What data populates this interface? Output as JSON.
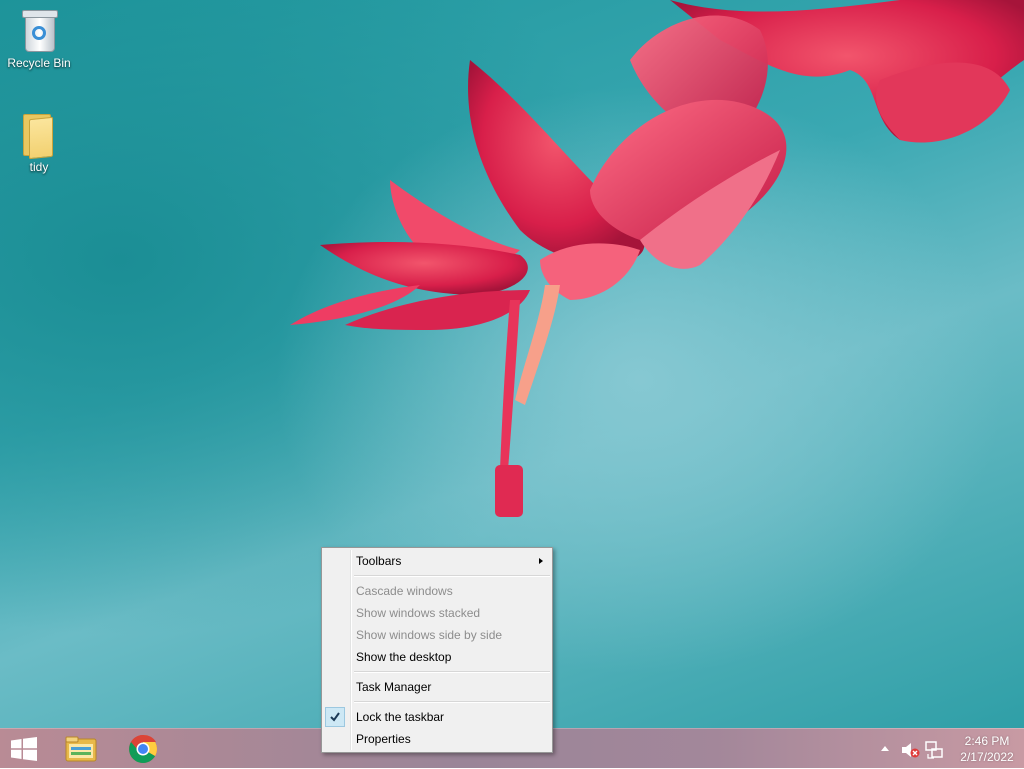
{
  "desktop": {
    "icons": [
      {
        "label": "Recycle Bin",
        "icon": "recycle-bin-icon"
      },
      {
        "label": "tidy",
        "icon": "folder-icon"
      }
    ]
  },
  "context_menu": {
    "items": [
      {
        "label": "Toolbars",
        "enabled": true,
        "submenu": true
      },
      {
        "label": "Cascade windows",
        "enabled": false
      },
      {
        "label": "Show windows stacked",
        "enabled": false
      },
      {
        "label": "Show windows side by side",
        "enabled": false
      },
      {
        "label": "Show the desktop",
        "enabled": true
      },
      {
        "label": "Task Manager",
        "enabled": true
      },
      {
        "label": "Lock the taskbar",
        "enabled": true,
        "checked": true
      },
      {
        "label": "Properties",
        "enabled": true
      }
    ]
  },
  "taskbar": {
    "start_icon": "windows-logo-icon",
    "pinned": [
      {
        "name": "File Explorer",
        "icon": "file-explorer-icon"
      },
      {
        "name": "Google Chrome",
        "icon": "chrome-icon"
      }
    ],
    "tray": {
      "icons": [
        "show-hidden-icons-icon",
        "volume-muted-icon",
        "network-icon"
      ]
    },
    "clock": {
      "time": "2:46 PM",
      "date": "2/17/2022"
    }
  },
  "colors": {
    "menu_background": "#f0f0f0",
    "menu_disabled_text": "#8d8d8d",
    "check_highlight": "#cde8f5",
    "desktop_teal": "#3aa8b2"
  }
}
